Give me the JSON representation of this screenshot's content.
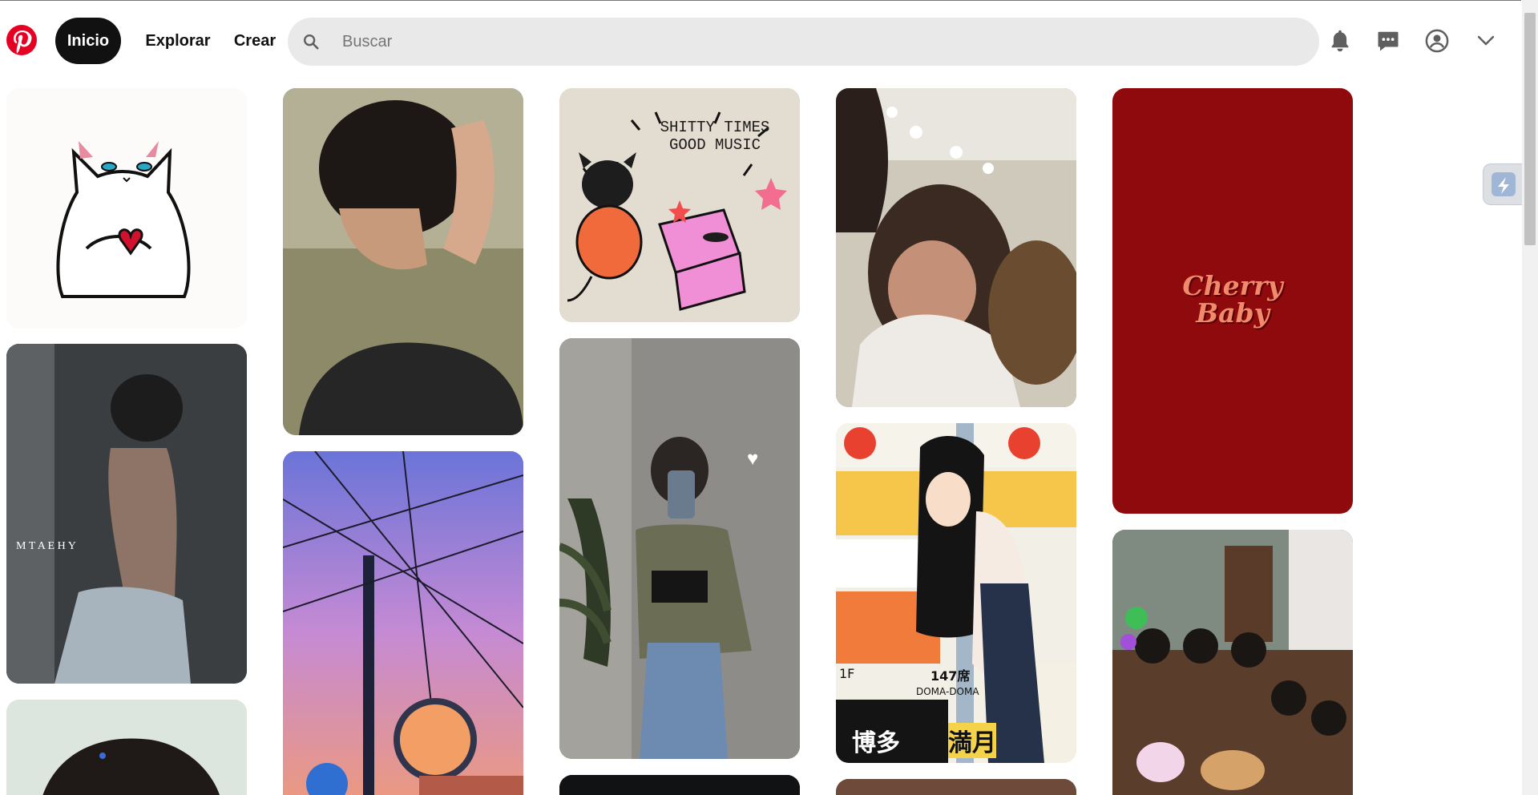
{
  "nav": {
    "home": "Inicio",
    "explore": "Explorar",
    "create": "Crear"
  },
  "search": {
    "placeholder": "Buscar"
  },
  "icons": {
    "logo": "pinterest-logo",
    "search": "search-icon",
    "notifications": "bell-icon",
    "messages": "chat-icon",
    "profile": "user-circle-icon",
    "menu": "chevron-down-icon"
  },
  "colors": {
    "brand": "#e60023",
    "active_pill": "#111111",
    "search_bg": "#e9e9e9"
  },
  "pins": {
    "shirt_line1": "SHITTY TIMES",
    "shirt_line2": "GOOD MUSIC",
    "cherry_line1": "Cherry",
    "cherry_line2": "Baby",
    "mtaehy": "M  T  A  E  H  Y",
    "sign_147": "147席",
    "sign_doma": "DOMA-DOMA",
    "sign_1f": "1F",
    "sign_hakata": "博多",
    "sign_mangetsu": "満月"
  }
}
